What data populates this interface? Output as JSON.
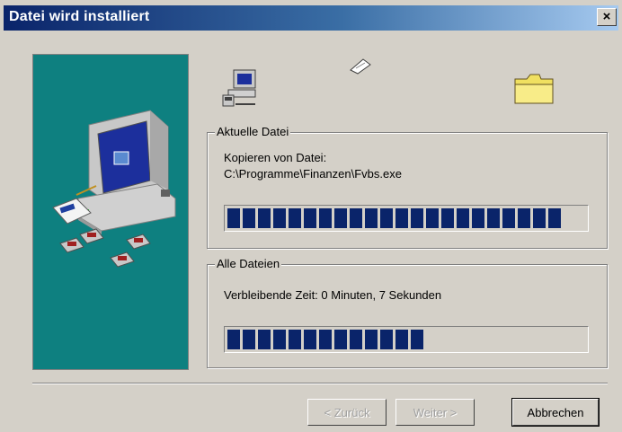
{
  "window": {
    "title": "Datei wird installiert",
    "close_glyph": "×"
  },
  "current_file": {
    "legend": "Aktuelle Datei",
    "line1": "Kopieren von Datei:",
    "line2": "C:\\Programme\\Finanzen\\Fvbs.exe",
    "progress_percent": 95
  },
  "all_files": {
    "legend": "Alle Dateien",
    "remaining": "Verbleibende Zeit: 0 Minuten, 7 Sekunden",
    "progress_percent": 55
  },
  "buttons": {
    "back": "< Zurück",
    "next": "Weiter >",
    "cancel": "Abbrechen"
  },
  "icons": {
    "wizard_image": "computer-with-disks-icon",
    "source": "computer-icon",
    "transfer": "flying-paper-icon",
    "destination": "folder-icon"
  },
  "colors": {
    "title_active": "#0a246a",
    "panel_teal": "#0e8080",
    "progress": "#0a246a",
    "face": "#d4d0c8"
  }
}
